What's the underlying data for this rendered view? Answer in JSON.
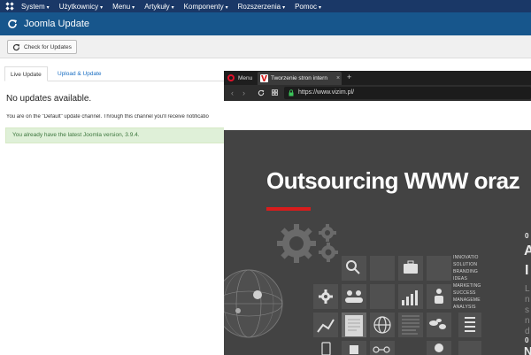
{
  "joomla": {
    "topnav": {
      "items": [
        {
          "label": "System",
          "caret": "▾"
        },
        {
          "label": "Użytkownicy",
          "caret": "▾"
        },
        {
          "label": "Menu",
          "caret": "▾"
        },
        {
          "label": "Artykuły",
          "caret": "▾"
        },
        {
          "label": "Komponenty",
          "caret": "▾"
        },
        {
          "label": "Rozszerzenia",
          "caret": "▾"
        },
        {
          "label": "Pomoc",
          "caret": "▾"
        }
      ]
    },
    "page_title": "Joomla Update",
    "toolbar": {
      "check_label": "Check for Updates"
    },
    "tabs": [
      {
        "label": "Live Update",
        "active": true
      },
      {
        "label": "Upload & Update",
        "active": false
      }
    ],
    "status_heading": "No updates available.",
    "channel_text": "You are on the \"Default\" update channel. Through this channel you'll receive notificatio",
    "alert_text": "You already have the latest Joomla version, 3.9.4.",
    "colors": {
      "navbar": "#1a3867",
      "titlebar": "#17568c",
      "alert_bg": "#dff0d8",
      "alert_text": "#3c763d"
    }
  },
  "browser": {
    "menu_label": "Menu",
    "tab_title": "Tworzenie stron intern",
    "tab_close": "×",
    "new_tab": "+",
    "url": "https://www.vizim.pl/",
    "hero": {
      "title": "Outsourcing WWW oraz",
      "words": [
        "INNOVATIO",
        "SOLUTION",
        "BRANDING",
        "IDEAS",
        "MARKETING",
        "SUCCESS",
        "MANAGEME",
        "ANALYSIS"
      ],
      "side_fragments": [
        "0",
        "A",
        "I",
        "L",
        "n",
        "s",
        "n",
        "d",
        "0",
        "N"
      ]
    },
    "colors": {
      "accent_red": "#d91c1c",
      "hero_bg": "#434343",
      "opera_red": "#e0112b"
    }
  }
}
